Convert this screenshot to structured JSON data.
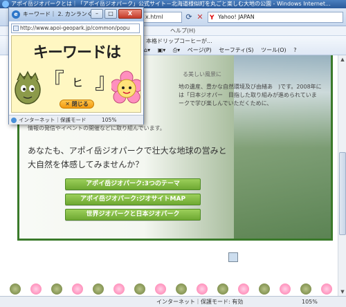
{
  "main_window": {
    "title": "アポイ岳ジオパークとは｜「アポイ岳ジオパーク」公式サイト－北海道様似町を丸ごと楽しむ大地の公園 - Windows Internet...",
    "address_fragment": "x.html",
    "search_text": "Yahoo! JAPAN",
    "menu_help": "ヘルプ(H)",
    "favorites_text": "本格ドリップコーヒーが...",
    "cmd_page": "ページ(P)",
    "cmd_safety": "セーフティ(S)",
    "cmd_tools": "ツール(O)",
    "cmd_help": "?"
  },
  "content": {
    "top_line": "る美しい風景に",
    "intro": "地の遺産、豊かな自然環境及び由緒あ　)です。2008年には「日本ジオパー　目指した取り組みが進められていま　ークで学び楽しんでいただくために、",
    "info_line": "情報の発信やイベントの開催などに取り組んでいます。",
    "big_line1": "あなたも、アポイ岳ジオパークで壮大な地球の営みと",
    "big_line2": "大自然を体感してみませんか？",
    "buttons": [
      "アポイ岳ジオパーク:3つのテーマ",
      "アポイ岳ジオパーク:ジオサイトMAP",
      "世界ジオパークと日本ジオパーク"
    ]
  },
  "status_bar": {
    "zone": "インターネット｜保護モード: 有効",
    "zoom": "105%"
  },
  "popup": {
    "title": "キーワード｜ 2. カンランく...",
    "url": "http://www.apoi-geopark.jp/common/popu",
    "heading": "キーワードは",
    "bracket_left": "『",
    "bracket_right": "』",
    "keyword_char": "ヒ",
    "close_label": "閉じる",
    "status_zone": "インターネット｜保護モード",
    "status_zoom": "105%",
    "close_window_label": "X"
  }
}
